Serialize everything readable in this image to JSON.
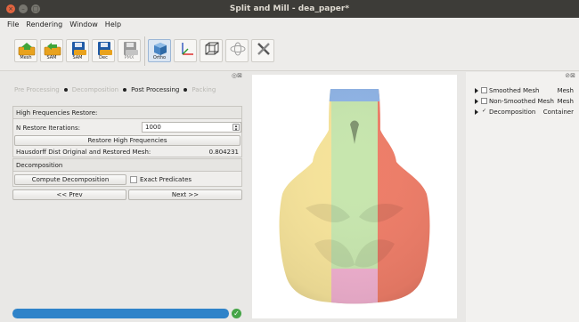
{
  "window": {
    "title": "Split and Mill - dea_paper*",
    "close_glyph": "×",
    "min_glyph": "–",
    "max_glyph": "□"
  },
  "menu": [
    "File",
    "Rendering",
    "Window",
    "Help"
  ],
  "toolbar": {
    "buttons": [
      {
        "label": "Mesh",
        "icon": "mesh-load-icon"
      },
      {
        "label": "SAM",
        "icon": "sam-load-icon"
      },
      {
        "label": "SAM",
        "icon": "save-sam-icon"
      },
      {
        "label": "Dec",
        "icon": "save-dec-icon"
      },
      {
        "label": "PMX",
        "icon": "save-pmx-icon"
      },
      {
        "label": "Ortho",
        "icon": "ortho-cube-icon"
      },
      {
        "label": "",
        "icon": "axes-icon"
      },
      {
        "label": "",
        "icon": "wireframe-cube-icon"
      },
      {
        "label": "",
        "icon": "orbit-icon"
      },
      {
        "label": "",
        "icon": "tools-icon"
      }
    ]
  },
  "left_dock": {
    "dock_glyphs": "◎⊠"
  },
  "wizard": {
    "steps": [
      "Pre Processing",
      "Decomposition",
      "Post Processing",
      "Packing"
    ],
    "active_index": 2
  },
  "high_freq": {
    "title": "High Frequencies Restore:",
    "iterations_label": "N Restore Iterations:",
    "iterations_value": "1000",
    "restore_button": "Restore High Frequencies",
    "hausdorff_label": "Hausdorff Dist Original and Restored Mesh:",
    "hausdorff_value": "0.804231"
  },
  "decomposition": {
    "title": "Decomposition",
    "compute_button": "Compute Decomposition",
    "exact_label": "Exact Predicates",
    "exact_checked": false
  },
  "nav": {
    "prev": "<< Prev",
    "next": "Next >>"
  },
  "progress": {
    "value": 1.0,
    "status_glyph": "✓"
  },
  "right_dock": {
    "dock_glyphs": "⊘⊠"
  },
  "scene_tree": [
    {
      "name": "Smoothed Mesh",
      "type": "Mesh",
      "checked": false
    },
    {
      "name": "Non-Smoothed Mesh",
      "type": "Mesh",
      "checked": false
    },
    {
      "name": "Decomposition",
      "type": "Container",
      "checked": true
    }
  ],
  "colors": {
    "accent": "#2f83c9",
    "part_yellow": "#f6e39a",
    "part_green": "#c7e6ae",
    "part_red": "#ee7d68",
    "part_blue": "#8fb4e6",
    "part_pink": "#f0b0cf"
  }
}
